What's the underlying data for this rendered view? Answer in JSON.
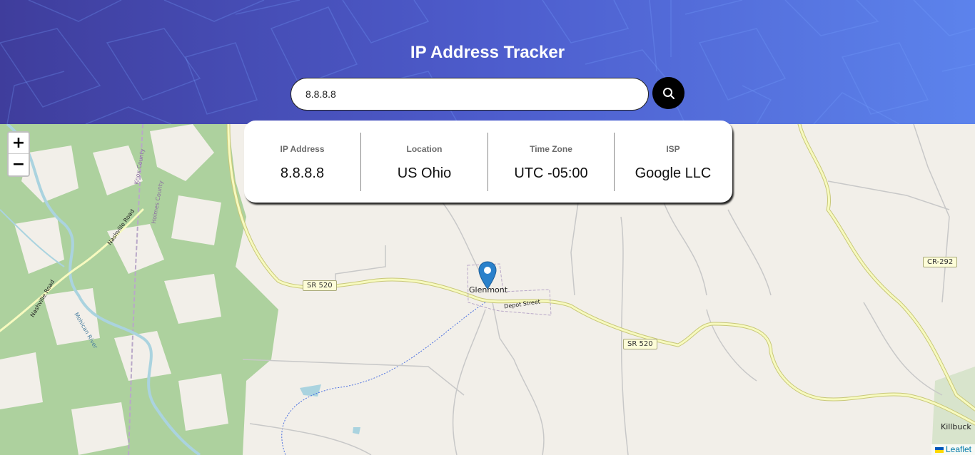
{
  "header": {
    "title": "IP Address Tracker",
    "search": {
      "value": "8.8.8.8",
      "icon": "search-icon"
    }
  },
  "info": {
    "ip": {
      "label": "IP Address",
      "value": "8.8.8.8"
    },
    "location": {
      "label": "Location",
      "value": "US Ohio"
    },
    "timezone": {
      "label": "Time Zone",
      "value": "UTC -05:00"
    },
    "isp": {
      "label": "ISP",
      "value": "Google LLC"
    }
  },
  "map": {
    "zoom_in": "+",
    "zoom_out": "−",
    "marker_icon": "map-pin-icon",
    "labels": {
      "town": "Glenmont",
      "depot": "Depot Street",
      "sr520_a": "SR 520",
      "sr520_b": "SR 520",
      "cr292": "CR-292",
      "killbuck": "Killbuck",
      "knox": "Knox County",
      "holmes": "Holmes County",
      "nashville_a": "Nashville Road",
      "nashville_b": "Nashville Road",
      "mohican": "Mohican River"
    },
    "attribution": "Leaflet"
  },
  "colors": {
    "header_start": "#3f3d9c",
    "header_end": "#5c83ec",
    "forest": "#add19e",
    "land": "#f2efe9",
    "road_primary": "#f7fabf",
    "road_primary_edge": "#c9c87a",
    "river": "#aad3df",
    "marker": "#2a81cb"
  }
}
